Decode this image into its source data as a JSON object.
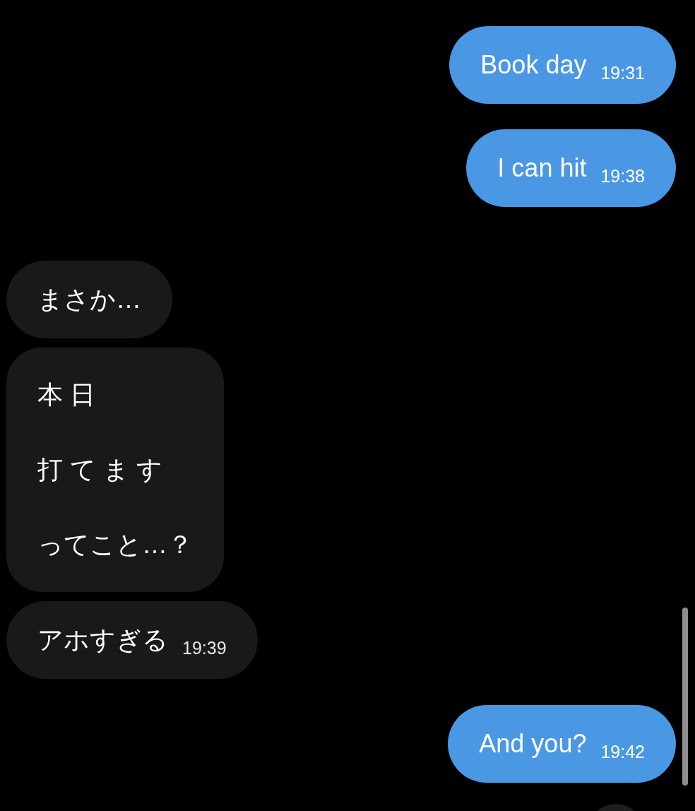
{
  "messages": [
    {
      "kind": "outgoing",
      "lines": [
        "Book day"
      ],
      "time": "19:31"
    },
    {
      "kind": "outgoing",
      "lines": [
        "I can hit"
      ],
      "time": "19:38"
    },
    {
      "kind": "incoming",
      "lines": [
        "まさか…"
      ]
    },
    {
      "kind": "incoming",
      "lines": [
        "本 日",
        "打 て ま す",
        "ってこと…？"
      ]
    },
    {
      "kind": "incoming",
      "lines": [
        "アホすぎる"
      ],
      "time": "19:39"
    },
    {
      "kind": "outgoing",
      "lines": [
        "And you?"
      ],
      "time": "19:42"
    }
  ]
}
